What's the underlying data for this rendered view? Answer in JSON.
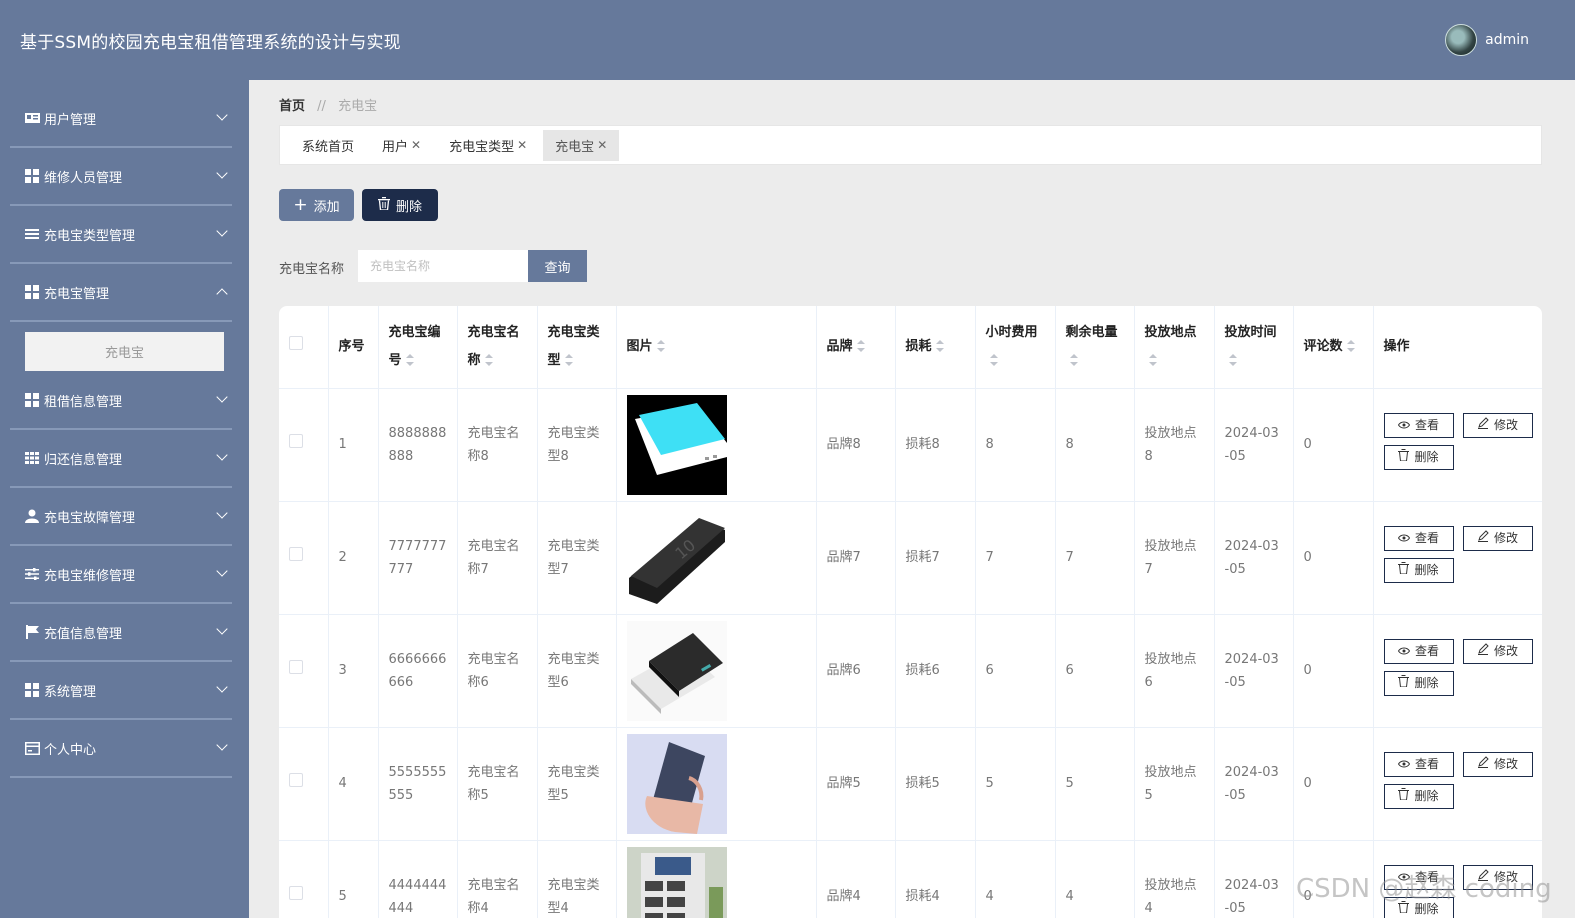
{
  "header": {
    "title": "基于SSM的校园充电宝租借管理系统的设计与实现",
    "username": "admin"
  },
  "sidebar": {
    "items": [
      {
        "label": "用户管理",
        "icon": "id-card-icon"
      },
      {
        "label": "维修人员管理",
        "icon": "grid-icon"
      },
      {
        "label": "充电宝类型管理",
        "icon": "list-icon"
      },
      {
        "label": "充电宝管理",
        "icon": "grid-icon"
      },
      {
        "label": "租借信息管理",
        "icon": "grid-icon"
      },
      {
        "label": "归还信息管理",
        "icon": "table-icon"
      },
      {
        "label": "充电宝故障管理",
        "icon": "user-icon"
      },
      {
        "label": "充电宝维修管理",
        "icon": "sliders-icon"
      },
      {
        "label": "充值信息管理",
        "icon": "flag-icon"
      },
      {
        "label": "系统管理",
        "icon": "grid-icon"
      },
      {
        "label": "个人中心",
        "icon": "card-icon"
      }
    ],
    "submenu": {
      "label": "充电宝"
    }
  },
  "breadcrumb": {
    "home": "首页",
    "separator": "//",
    "current": "充电宝"
  },
  "tabs": [
    {
      "label": "系统首页",
      "closable": false
    },
    {
      "label": "用户",
      "closable": true
    },
    {
      "label": "充电宝类型",
      "closable": true
    },
    {
      "label": "充电宝",
      "closable": true
    }
  ],
  "toolbar": {
    "add_label": "添加",
    "delete_label": "删除"
  },
  "search": {
    "label": "充电宝名称",
    "placeholder": "充电宝名称",
    "button": "查询"
  },
  "table": {
    "columns": [
      "序号",
      "充电宝编号",
      "充电宝名称",
      "充电宝类型",
      "图片",
      "品牌",
      "损耗",
      "小时费用",
      "剩余电量",
      "投放地点",
      "投放时间",
      "评论数",
      "操作"
    ],
    "rows": [
      {
        "index": "1",
        "code": "8888888888",
        "name": "充电宝名称8",
        "type": "充电宝类型8",
        "brand": "品牌8",
        "loss": "损耗8",
        "fee": "8",
        "power": "8",
        "location": "投放地点8",
        "time": "2024-03-05",
        "comments": "0"
      },
      {
        "index": "2",
        "code": "7777777777",
        "name": "充电宝名称7",
        "type": "充电宝类型7",
        "brand": "品牌7",
        "loss": "损耗7",
        "fee": "7",
        "power": "7",
        "location": "投放地点7",
        "time": "2024-03-05",
        "comments": "0"
      },
      {
        "index": "3",
        "code": "6666666666",
        "name": "充电宝名称6",
        "type": "充电宝类型6",
        "brand": "品牌6",
        "loss": "损耗6",
        "fee": "6",
        "power": "6",
        "location": "投放地点6",
        "time": "2024-03-05",
        "comments": "0"
      },
      {
        "index": "4",
        "code": "5555555555",
        "name": "充电宝名称5",
        "type": "充电宝类型5",
        "brand": "品牌5",
        "loss": "损耗5",
        "fee": "5",
        "power": "5",
        "location": "投放地点5",
        "time": "2024-03-05",
        "comments": "0"
      },
      {
        "index": "5",
        "code": "4444444444",
        "name": "充电宝名称4",
        "type": "充电宝类型4",
        "brand": "品牌4",
        "loss": "损耗4",
        "fee": "4",
        "power": "4",
        "location": "投放地点4",
        "time": "2024-03-05",
        "comments": "0"
      }
    ],
    "actions": {
      "view": "查看",
      "edit": "修改",
      "delete": "删除"
    }
  },
  "watermark": "CSDN @赵森 coding",
  "colors": {
    "primary": "#66799b",
    "dark": "#1d2c4a",
    "background": "#ececec"
  }
}
